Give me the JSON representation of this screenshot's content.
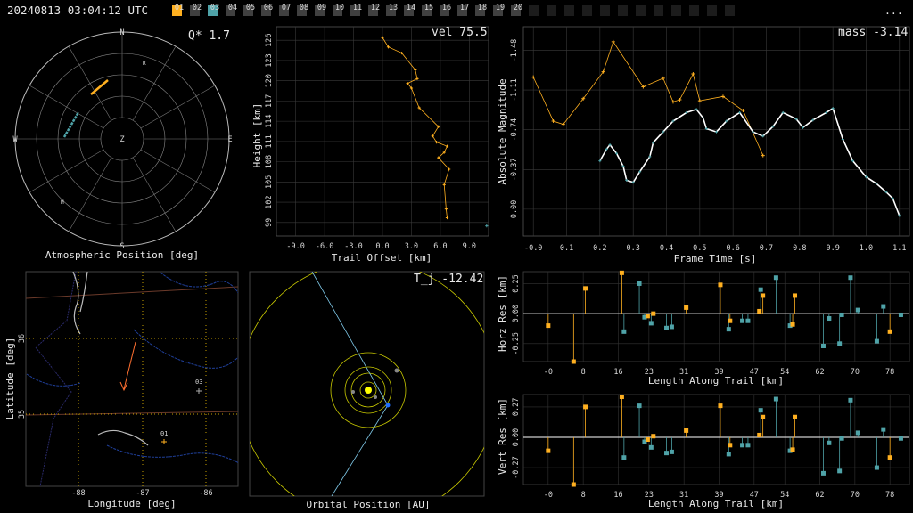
{
  "timestamp": "20240813 03:04:12 UTC",
  "more_label": "...",
  "colors": {
    "orange": "#ffb020",
    "teal": "#4fa3a8",
    "white": "#ffffff",
    "grid": "#606060",
    "blueLine": "#1f3f9a"
  },
  "stations": [
    "01",
    "02",
    "03",
    "04",
    "05",
    "06",
    "07",
    "08",
    "09",
    "10",
    "11",
    "12",
    "13",
    "14",
    "15",
    "16",
    "17",
    "18",
    "19",
    "20"
  ],
  "station_states": [
    "orange",
    "gray",
    "teal",
    "gray",
    "gray",
    "gray",
    "gray",
    "gray",
    "gray",
    "gray",
    "gray",
    "gray",
    "gray",
    "gray",
    "gray",
    "gray",
    "gray",
    "gray",
    "gray",
    "gray",
    "dark",
    "dark",
    "dark",
    "dark",
    "dark",
    "dark",
    "dark",
    "dark",
    "dark",
    "dark",
    "dark",
    "dark"
  ],
  "polar": {
    "readout": "Q*  1.7",
    "title": "Atmospheric Position [deg]",
    "dirs": {
      "N": "N",
      "S": "S",
      "E": "E",
      "W": "W",
      "Z": "Z"
    },
    "markers": {
      "R": "R",
      "M": "M"
    }
  },
  "height": {
    "readout": "vel 75.5",
    "xlabel": "Trail Offset [km]",
    "ylabel": "Height [km]",
    "xticks": [
      "-9.0",
      "-6.0",
      "-3.0",
      "0.0",
      "3.0",
      "6.0",
      "9.0"
    ],
    "yticks": [
      "99",
      "102",
      "105",
      "108",
      "111",
      "114",
      "117",
      "120",
      "123",
      "126"
    ]
  },
  "mag": {
    "readout": "mass -3.14",
    "xlabel": "Frame Time [s]",
    "ylabel": "Absolute Magnitude",
    "xticks": [
      "-0.0",
      "0.1",
      "0.2",
      "0.3",
      "0.4",
      "0.5",
      "0.6",
      "0.7",
      "0.8",
      "0.9",
      "1.0",
      "1.1"
    ],
    "yticks": [
      "-1.48",
      "-1.11",
      "-0.74",
      "-0.37",
      "0.00"
    ]
  },
  "map": {
    "xlabel": "Longitude [deg]",
    "ylabel": "Latitude [deg]",
    "xticks": [
      "-88",
      "-87",
      "-86"
    ],
    "yticks": [
      "36",
      "35"
    ],
    "station_labels": [
      "03",
      "01"
    ]
  },
  "orbit": {
    "readout": "T_j -12.42",
    "xlabel": "Orbital Position [AU]"
  },
  "horz": {
    "xlabel": "Length Along Trail [km]",
    "ylabel": "Horz Res [km]",
    "xticks": [
      "-0",
      "8",
      "16",
      "23",
      "31",
      "39",
      "47",
      "54",
      "62",
      "70",
      "78"
    ],
    "yticks": [
      "0.25",
      "0.00",
      "-0.25"
    ]
  },
  "vert": {
    "xlabel": "Length Along Trail [km]",
    "ylabel": "Vert Res [km]",
    "xticks": [
      "-0",
      "8",
      "16",
      "23",
      "31",
      "39",
      "47",
      "54",
      "62",
      "70",
      "78"
    ],
    "yticks": [
      "0.27",
      "0.00",
      "-0.27"
    ]
  },
  "chart_data": [
    {
      "type": "line",
      "name": "height-vs-offset",
      "xlabel": "Trail Offset [km]",
      "ylabel": "Height [km]",
      "xlim": [
        -11,
        11
      ],
      "ylim": [
        97,
        128
      ],
      "points": [
        [
          0,
          126.4
        ],
        [
          0.6,
          125.0
        ],
        [
          2.0,
          124.1
        ],
        [
          3.4,
          121.6
        ],
        [
          3.6,
          120.3
        ],
        [
          2.6,
          119.6
        ],
        [
          3.0,
          118.9
        ],
        [
          3.8,
          116.0
        ],
        [
          5.8,
          113.2
        ],
        [
          5.2,
          111.8
        ],
        [
          5.6,
          110.9
        ],
        [
          6.7,
          110.3
        ],
        [
          6.4,
          109.4
        ],
        [
          5.8,
          108.6
        ],
        [
          6.9,
          106.9
        ],
        [
          6.4,
          104.6
        ],
        [
          6.6,
          101.0
        ],
        [
          6.7,
          99.7
        ]
      ],
      "extra_point": [
        10.8,
        98.5
      ]
    },
    {
      "type": "line",
      "name": "magnitude-vs-time",
      "xlabel": "Frame Time [s]",
      "ylabel": "Absolute Magnitude",
      "xlim": [
        -0.03,
        1.13
      ],
      "ylim": [
        -1.7,
        0.25
      ],
      "orange": [
        [
          0.0,
          -1.23
        ],
        [
          0.06,
          -0.82
        ],
        [
          0.09,
          -0.79
        ],
        [
          0.15,
          -1.03
        ],
        [
          0.21,
          -1.28
        ],
        [
          0.24,
          -1.56
        ],
        [
          0.33,
          -1.14
        ],
        [
          0.39,
          -1.22
        ],
        [
          0.42,
          -1.0
        ],
        [
          0.44,
          -1.02
        ],
        [
          0.48,
          -1.26
        ],
        [
          0.5,
          -1.01
        ],
        [
          0.57,
          -1.05
        ],
        [
          0.63,
          -0.92
        ],
        [
          0.69,
          -0.5
        ]
      ],
      "white": [
        [
          0.2,
          -0.45
        ],
        [
          0.22,
          -0.56
        ],
        [
          0.23,
          -0.6
        ],
        [
          0.25,
          -0.52
        ],
        [
          0.27,
          -0.4
        ],
        [
          0.28,
          -0.27
        ],
        [
          0.3,
          -0.25
        ],
        [
          0.32,
          -0.35
        ],
        [
          0.35,
          -0.49
        ],
        [
          0.36,
          -0.62
        ],
        [
          0.39,
          -0.72
        ],
        [
          0.42,
          -0.82
        ],
        [
          0.46,
          -0.9
        ],
        [
          0.49,
          -0.93
        ],
        [
          0.51,
          -0.85
        ],
        [
          0.52,
          -0.75
        ],
        [
          0.55,
          -0.72
        ],
        [
          0.58,
          -0.82
        ],
        [
          0.62,
          -0.9
        ],
        [
          0.66,
          -0.72
        ],
        [
          0.69,
          -0.68
        ],
        [
          0.72,
          -0.77
        ],
        [
          0.75,
          -0.9
        ],
        [
          0.79,
          -0.84
        ],
        [
          0.81,
          -0.76
        ],
        [
          0.84,
          -0.83
        ],
        [
          0.88,
          -0.9
        ],
        [
          0.9,
          -0.94
        ],
        [
          0.93,
          -0.65
        ],
        [
          0.96,
          -0.45
        ],
        [
          1.0,
          -0.3
        ],
        [
          1.03,
          -0.24
        ],
        [
          1.06,
          -0.16
        ],
        [
          1.08,
          -0.1
        ],
        [
          1.1,
          0.06
        ]
      ]
    },
    {
      "type": "scatter",
      "name": "horizontal-residuals",
      "xlabel": "Length Along Trail [km]",
      "ylabel": "Horz Res [km]",
      "xlim": [
        -2,
        80
      ],
      "ylim": [
        -0.4,
        0.35
      ],
      "orange": [
        [
          0.0,
          -0.1
        ],
        [
          5.8,
          -0.4
        ],
        [
          8.5,
          0.21
        ],
        [
          16.8,
          0.34
        ],
        [
          22.7,
          -0.02
        ],
        [
          24.0,
          0.0
        ],
        [
          31.5,
          0.05
        ],
        [
          39.3,
          0.24
        ],
        [
          41.5,
          -0.06
        ],
        [
          48.2,
          0.02
        ],
        [
          49.0,
          0.15
        ],
        [
          55.8,
          -0.09
        ],
        [
          56.3,
          0.15
        ],
        [
          78.0,
          -0.15
        ]
      ],
      "teal": [
        [
          17.3,
          -0.15
        ],
        [
          20.8,
          0.25
        ],
        [
          22.0,
          -0.03
        ],
        [
          23.5,
          -0.08
        ],
        [
          27.0,
          -0.12
        ],
        [
          28.2,
          -0.11
        ],
        [
          41.2,
          -0.13
        ],
        [
          44.3,
          -0.06
        ],
        [
          45.6,
          -0.06
        ],
        [
          48.5,
          0.2
        ],
        [
          52.0,
          0.3
        ],
        [
          55.2,
          -0.1
        ],
        [
          62.8,
          -0.27
        ],
        [
          64.1,
          -0.04
        ],
        [
          66.5,
          -0.25
        ],
        [
          67.0,
          -0.01
        ],
        [
          69.0,
          0.3
        ],
        [
          70.7,
          0.03
        ],
        [
          75.0,
          -0.23
        ],
        [
          76.5,
          0.06
        ],
        [
          80.5,
          -0.01
        ]
      ]
    },
    {
      "type": "scatter",
      "name": "vertical-residuals",
      "xlabel": "Length Along Trail [km]",
      "ylabel": "Vert Res [km]",
      "xlim": [
        -2,
        80
      ],
      "ylim": [
        -0.42,
        0.38
      ],
      "orange": [
        [
          0.0,
          -0.12
        ],
        [
          5.8,
          -0.42
        ],
        [
          8.5,
          0.27
        ],
        [
          16.8,
          0.36
        ],
        [
          22.7,
          -0.02
        ],
        [
          24.0,
          0.01
        ],
        [
          31.5,
          0.06
        ],
        [
          39.3,
          0.28
        ],
        [
          41.5,
          -0.07
        ],
        [
          48.2,
          0.02
        ],
        [
          49.0,
          0.18
        ],
        [
          55.8,
          -0.11
        ],
        [
          56.3,
          0.18
        ],
        [
          78.0,
          -0.18
        ]
      ],
      "teal": [
        [
          17.3,
          -0.18
        ],
        [
          20.8,
          0.28
        ],
        [
          22.0,
          -0.04
        ],
        [
          23.5,
          -0.09
        ],
        [
          27.0,
          -0.14
        ],
        [
          28.2,
          -0.13
        ],
        [
          41.2,
          -0.15
        ],
        [
          44.3,
          -0.07
        ],
        [
          45.6,
          -0.07
        ],
        [
          48.5,
          0.24
        ],
        [
          52.0,
          0.34
        ],
        [
          55.2,
          -0.12
        ],
        [
          62.8,
          -0.32
        ],
        [
          64.1,
          -0.05
        ],
        [
          66.5,
          -0.3
        ],
        [
          67.0,
          -0.01
        ],
        [
          69.0,
          0.33
        ],
        [
          70.7,
          0.04
        ],
        [
          75.0,
          -0.27
        ],
        [
          76.5,
          0.07
        ],
        [
          80.5,
          -0.01
        ]
      ]
    }
  ]
}
